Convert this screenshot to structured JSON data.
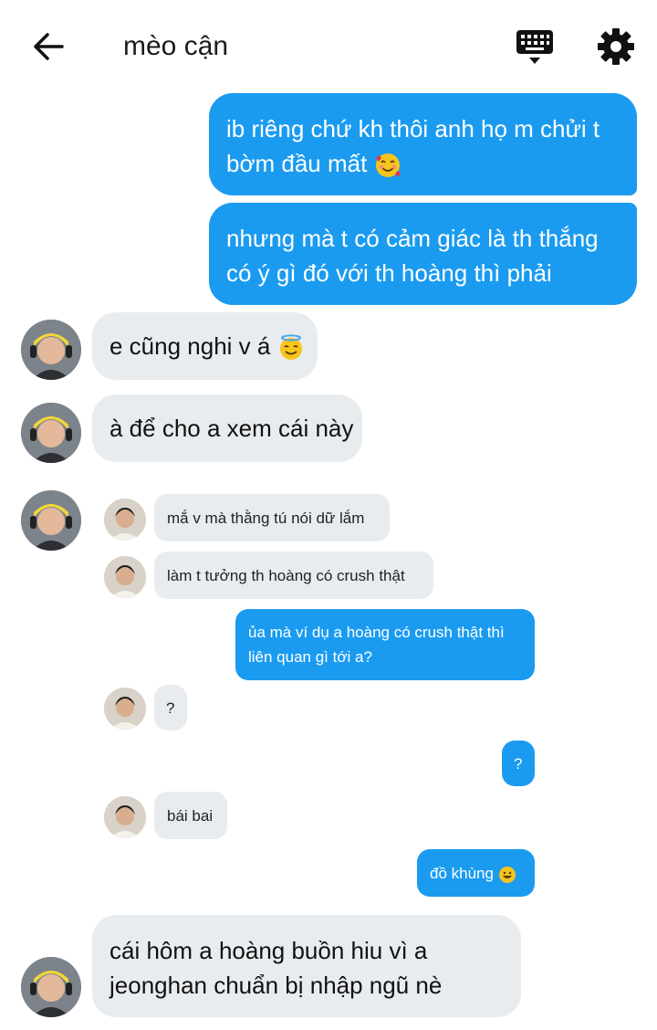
{
  "header": {
    "title": "mèo cận",
    "back_icon": "arrow-left-icon",
    "keyboard_icon": "keyboard-hide-icon",
    "settings_icon": "gear-icon"
  },
  "messages": {
    "m1_line1": "ib riêng chứ kh thôi anh họ m chửi t",
    "m1_line2": "bờm đầu mất",
    "m2_line1": "nhưng mà t có cảm giác là th thắng",
    "m2_line2": "có ý gì đó với th hoàng thì phải",
    "m3": "e cũng nghi v á",
    "m4": "à để cho a xem cái này",
    "m5_line1": "cái hôm a hoàng buồn hiu vì a",
    "m5_line2": "jeonghan chuẩn bị nhập ngũ nè"
  },
  "screenshot": {
    "s1": "mắ v mà thằng tú nói dữ lắm",
    "s2": "làm t tưởng th hoàng có crush thật",
    "s3_line1": "ủa mà ví dụ a hoàng có crush thật thì",
    "s3_line2": "liên quan gì tới a?",
    "s4": "?",
    "s5": "?",
    "s6": "bái bai",
    "s7": "đồ khùng"
  },
  "colors": {
    "outgoing": "#1a9bf0",
    "incoming": "#e9ecef"
  }
}
